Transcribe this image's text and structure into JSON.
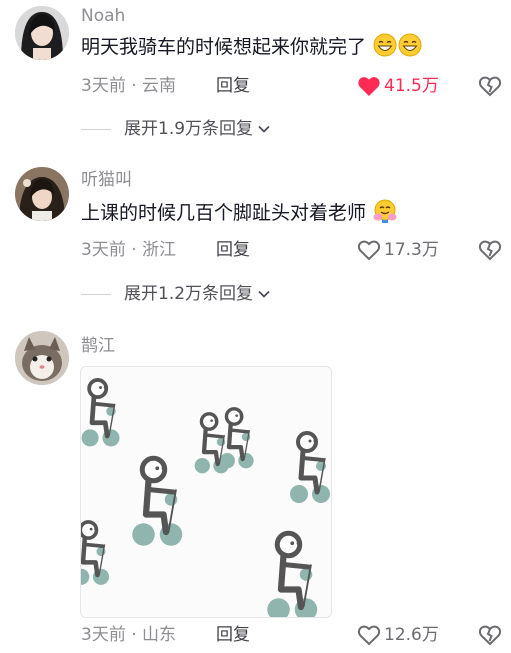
{
  "comments": [
    {
      "username": "Noah",
      "text": "明天我骑车的时候想起来你就完了",
      "emoji": [
        "grinning-face-emoji",
        "grinning-face-emoji"
      ],
      "meta": "3天前 · 云南",
      "reply_label": "回复",
      "likes": "41.5万",
      "liked": true,
      "expand_label": "展开1.9万条回复"
    },
    {
      "username": "听猫叫",
      "text": "上课的时候几百个脚趾头对着老师",
      "emoji": [
        "hugging-face-emoji"
      ],
      "meta": "3天前 · 浙江",
      "reply_label": "回复",
      "likes": "17.3万",
      "liked": false,
      "expand_label": "展开1.2万条回复"
    },
    {
      "username": "鹊江",
      "meta": "3天前 · 山东",
      "reply_label": "回复",
      "likes": "12.6万",
      "liked": false,
      "image": "stick-figures-cycling-meme"
    }
  ],
  "colors": {
    "liked_red": "#fe2c55",
    "meta_gray": "#8e8e93",
    "text_dark": "#161823",
    "wheel_teal": "#8fb5ae",
    "figure_gray": "#555555"
  }
}
